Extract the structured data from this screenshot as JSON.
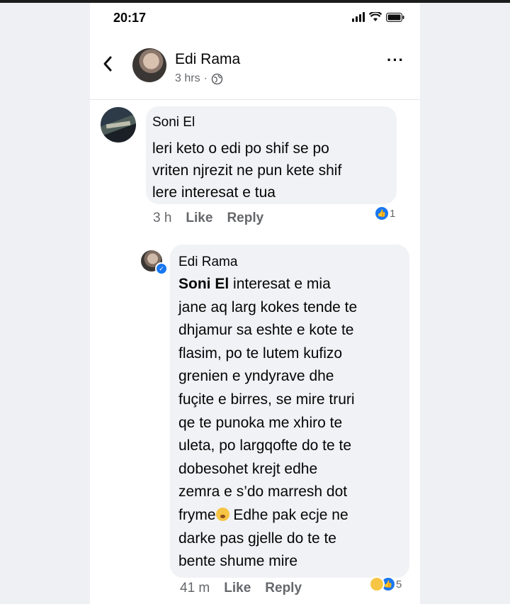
{
  "status_bar": {
    "time": "20:17"
  },
  "post_header": {
    "author": "Edi Rama",
    "time": "3 hrs",
    "separator": "·"
  },
  "comments": [
    {
      "author": "Soni El",
      "text": "leri keto o edi  po shif se po\nvriten njrezit ne pun kete shif\nlere  interesat e tua",
      "time": "3 h",
      "like_label": "Like",
      "reply_label": "Reply",
      "reaction_count": "1"
    }
  ],
  "reply": {
    "author": "Edi Rama",
    "mention": "Soni El",
    "text_part1": " interesat e mia\njane aq larg kokes tende te\ndhjamur sa eshte e kote te\nflasim, po te lutem kufizo\ngrenien e yndyrave dhe\nfuçite e birres, se mire truri\nqe te punoka me xhiro te\nuleta, po largqofte do te te\ndobesohet krejt edhe\nzemra e s’do marresh dot\nfryme",
    "text_part2": " Edhe pak ecje ne\ndarke pas gjelle do te te\nbente shume mire",
    "time": "41 m",
    "like_label": "Like",
    "reply_label": "Reply",
    "reaction_count": "5"
  },
  "colors": {
    "accent": "#1877f2",
    "bubble": "#f0f2f5",
    "meta": "#65676b"
  }
}
